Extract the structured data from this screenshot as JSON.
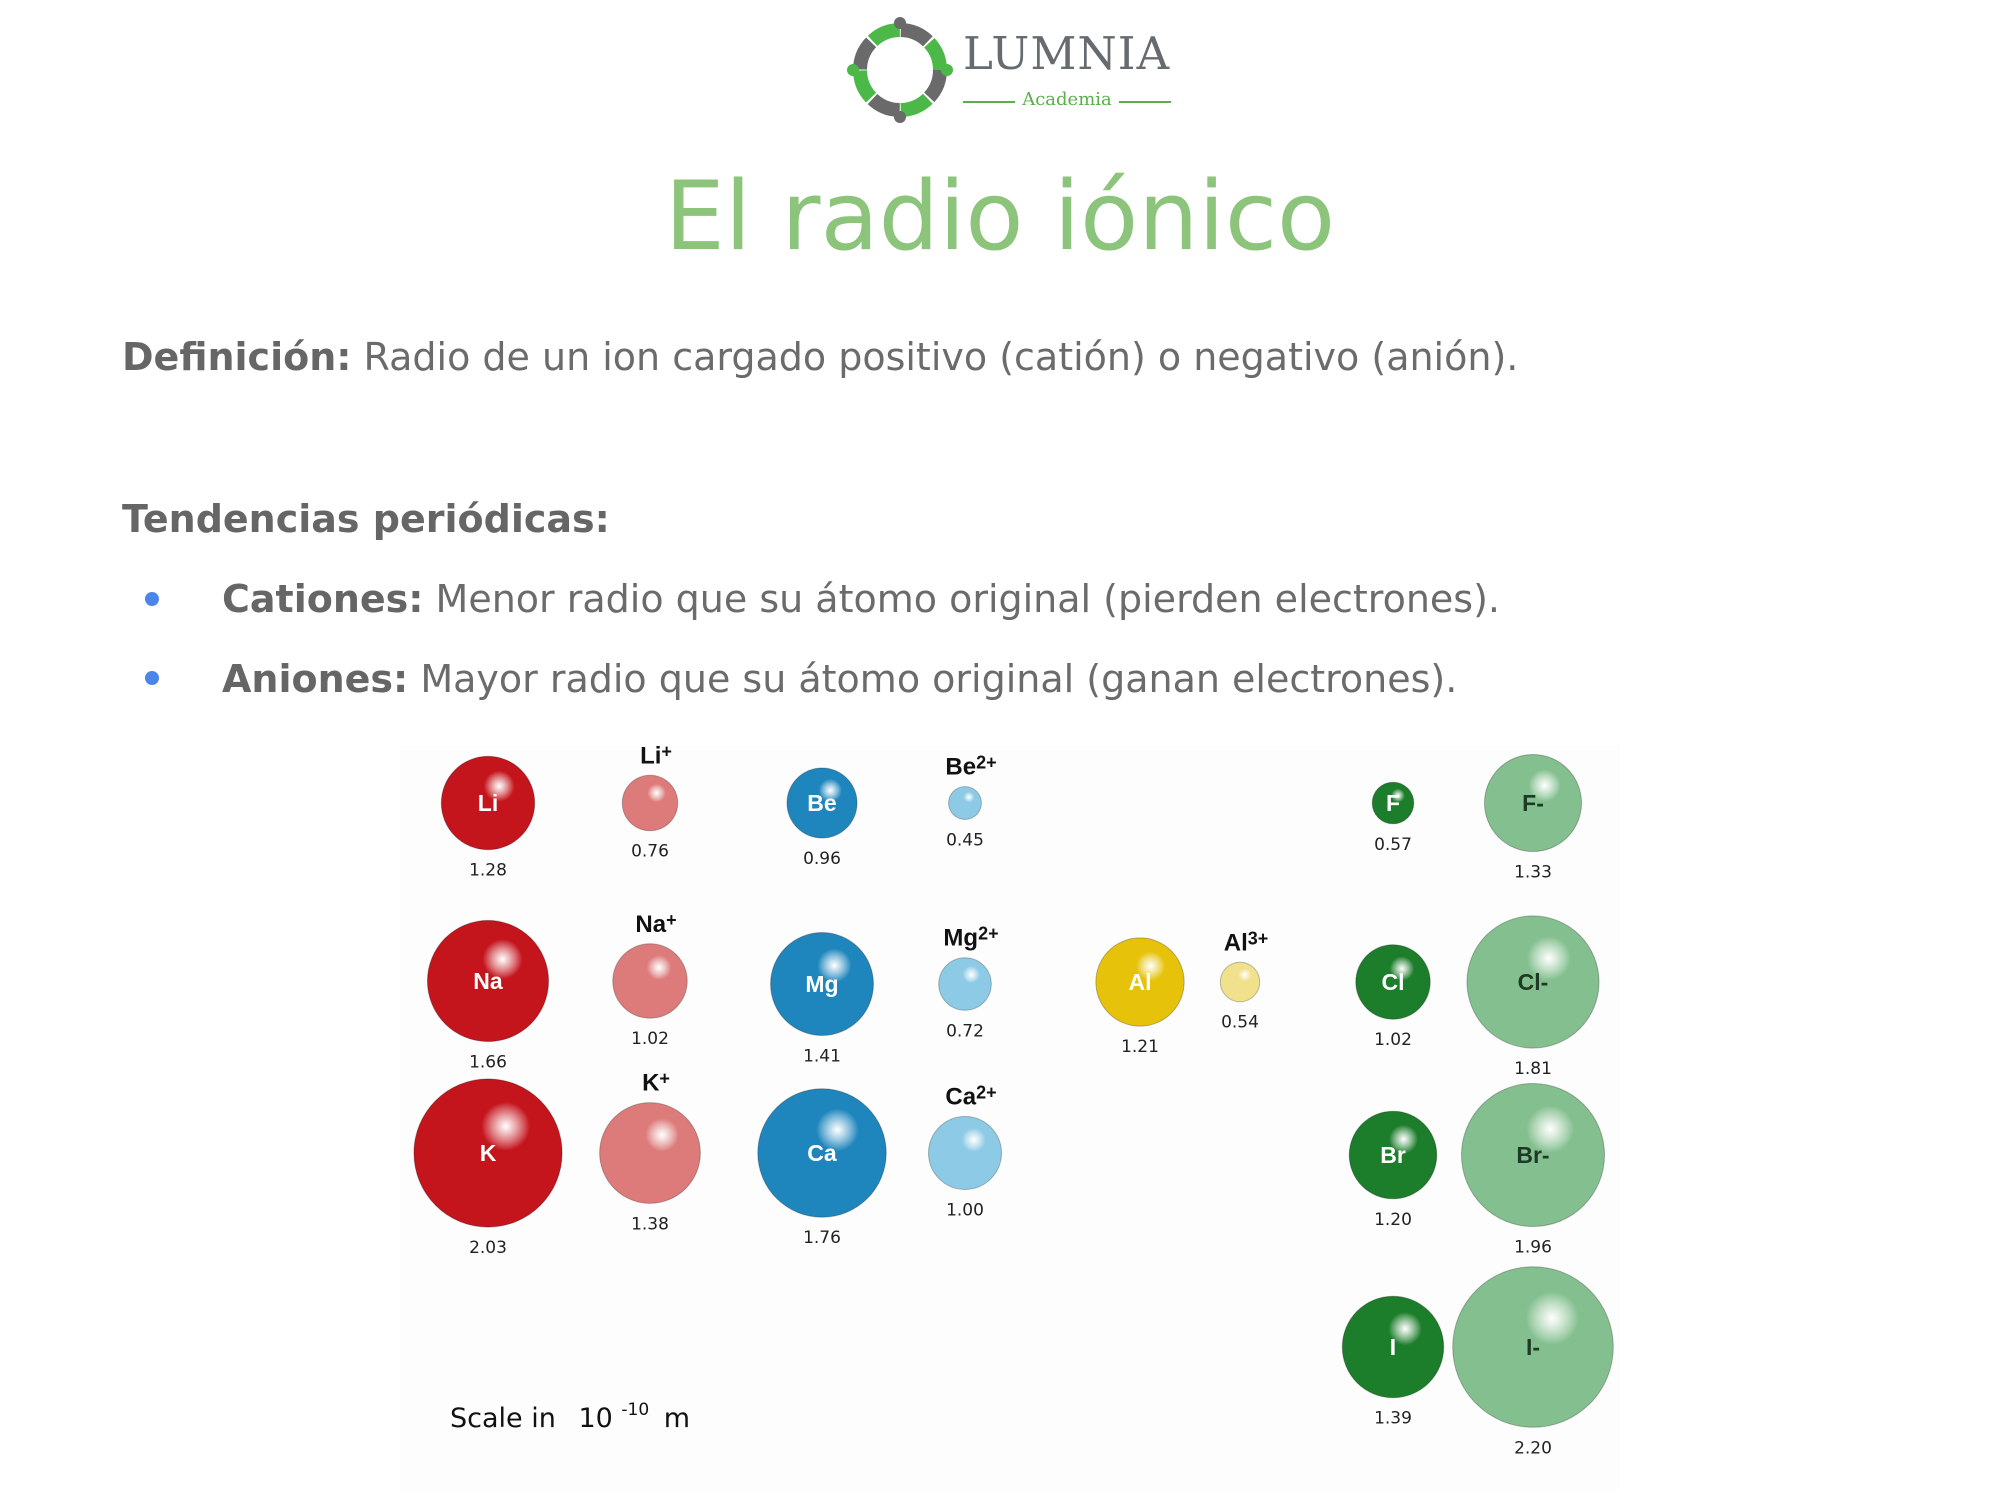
{
  "logo": {
    "name": "LUMNIA",
    "sub": "Academia"
  },
  "title": "El radio iónico",
  "definition": {
    "label": "Definición:",
    "text": " Radio de un ion cargado positivo (catión) o negativo (anión)."
  },
  "trends": {
    "heading": "Tendencias periódicas:",
    "items": [
      {
        "label": "Cationes:",
        "text": " Menor radio que su átomo original (pierden electrones)."
      },
      {
        "label": "Aniones:",
        "text": " Mayor radio que su átomo original (ganan electrones)."
      }
    ]
  },
  "figure": {
    "scale_label": "Scale in",
    "scale_base": "10",
    "scale_exp": "-10",
    "scale_unit": "m",
    "colors": {
      "red": "#c4141c",
      "red_ion": "#dd7b7b",
      "blue": "#1f86bd",
      "blue_ion": "#8ccae6",
      "yellow": "#e6c20a",
      "yellow_ion": "#f1e08c",
      "green": "#1c7d2a",
      "green_ion": "#84c08f"
    },
    "species": [
      {
        "label": "Li",
        "value": "1.28",
        "kind": "atom",
        "color": "red"
      },
      {
        "label": "Li+",
        "value": "0.76",
        "kind": "ion",
        "color": "red_ion"
      },
      {
        "label": "Na",
        "value": "1.66",
        "kind": "atom",
        "color": "red"
      },
      {
        "label": "Na+",
        "value": "1.02",
        "kind": "ion",
        "color": "red_ion"
      },
      {
        "label": "K",
        "value": "2.03",
        "kind": "atom",
        "color": "red"
      },
      {
        "label": "K+",
        "value": "1.38",
        "kind": "ion",
        "color": "red_ion"
      },
      {
        "label": "Be",
        "value": "0.96",
        "kind": "atom",
        "color": "blue"
      },
      {
        "label": "Be2+",
        "value": "0.45",
        "kind": "ion",
        "color": "blue_ion"
      },
      {
        "label": "Mg",
        "value": "1.41",
        "kind": "atom",
        "color": "blue"
      },
      {
        "label": "Mg2+",
        "value": "0.72",
        "kind": "ion",
        "color": "blue_ion"
      },
      {
        "label": "Ca",
        "value": "1.76",
        "kind": "atom",
        "color": "blue"
      },
      {
        "label": "Ca2+",
        "value": "1.00",
        "kind": "ion",
        "color": "blue_ion"
      },
      {
        "label": "Al",
        "value": "1.21",
        "kind": "atom",
        "color": "yellow"
      },
      {
        "label": "Al3+",
        "value": "0.54",
        "kind": "ion",
        "color": "yellow_ion"
      },
      {
        "label": "F",
        "value": "0.57",
        "kind": "atom",
        "color": "green"
      },
      {
        "label": "F-",
        "value": "1.33",
        "kind": "anion",
        "color": "green_ion"
      },
      {
        "label": "Cl",
        "value": "1.02",
        "kind": "atom",
        "color": "green"
      },
      {
        "label": "Cl-",
        "value": "1.81",
        "kind": "anion",
        "color": "green_ion"
      },
      {
        "label": "Br",
        "value": "1.20",
        "kind": "atom",
        "color": "green"
      },
      {
        "label": "Br-",
        "value": "1.96",
        "kind": "anion",
        "color": "green_ion"
      },
      {
        "label": "I",
        "value": "1.39",
        "kind": "atom",
        "color": "green"
      },
      {
        "label": "I-",
        "value": "2.20",
        "kind": "anion",
        "color": "green_ion"
      }
    ]
  }
}
